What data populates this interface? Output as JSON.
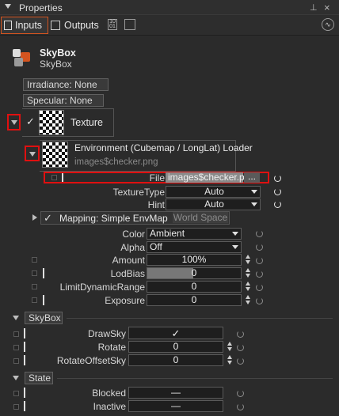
{
  "window": {
    "title": "Properties"
  },
  "tabs": {
    "inputs": "Inputs",
    "outputs": "Outputs"
  },
  "node": {
    "title": "SkyBox",
    "subtitle": "SkyBox"
  },
  "buttons": {
    "irradiance": "Irradiance:  None",
    "specular": "Specular:  None"
  },
  "texture": {
    "label": "Texture",
    "check": "✓"
  },
  "loader": {
    "title": "Environment (Cubemap / LongLat) Loader",
    "path": "images$checker.png"
  },
  "props": {
    "file": {
      "label": "File",
      "value": "images$checker.p...",
      "browse": "..."
    },
    "texture_type": {
      "label": "TextureType",
      "value": "Auto"
    },
    "hint": {
      "label": "Hint",
      "value": "Auto"
    },
    "mapping": {
      "check": "✓",
      "label": "Mapping:  Simple EnvMap",
      "alt": "World Space"
    },
    "color": {
      "label": "Color",
      "value": "Ambient"
    },
    "alpha": {
      "label": "Alpha",
      "value": "Off"
    },
    "amount": {
      "label": "Amount",
      "value": "100%"
    },
    "lodbias": {
      "label": "LodBias",
      "value": "0"
    },
    "limit": {
      "label": "LimitDynamicRange",
      "value": "0"
    },
    "exposure": {
      "label": "Exposure",
      "value": "0"
    }
  },
  "skybox_section": {
    "title": "SkyBox",
    "drawsky": {
      "label": "DrawSky",
      "value": "✓"
    },
    "rotate": {
      "label": "Rotate",
      "value": "0"
    },
    "rotate_offset": {
      "label": "RotateOffsetSky",
      "value": "0"
    }
  },
  "state_section": {
    "title": "State",
    "blocked": {
      "label": "Blocked",
      "value": "—"
    },
    "inactive": {
      "label": "Inactive",
      "value": "—"
    }
  }
}
